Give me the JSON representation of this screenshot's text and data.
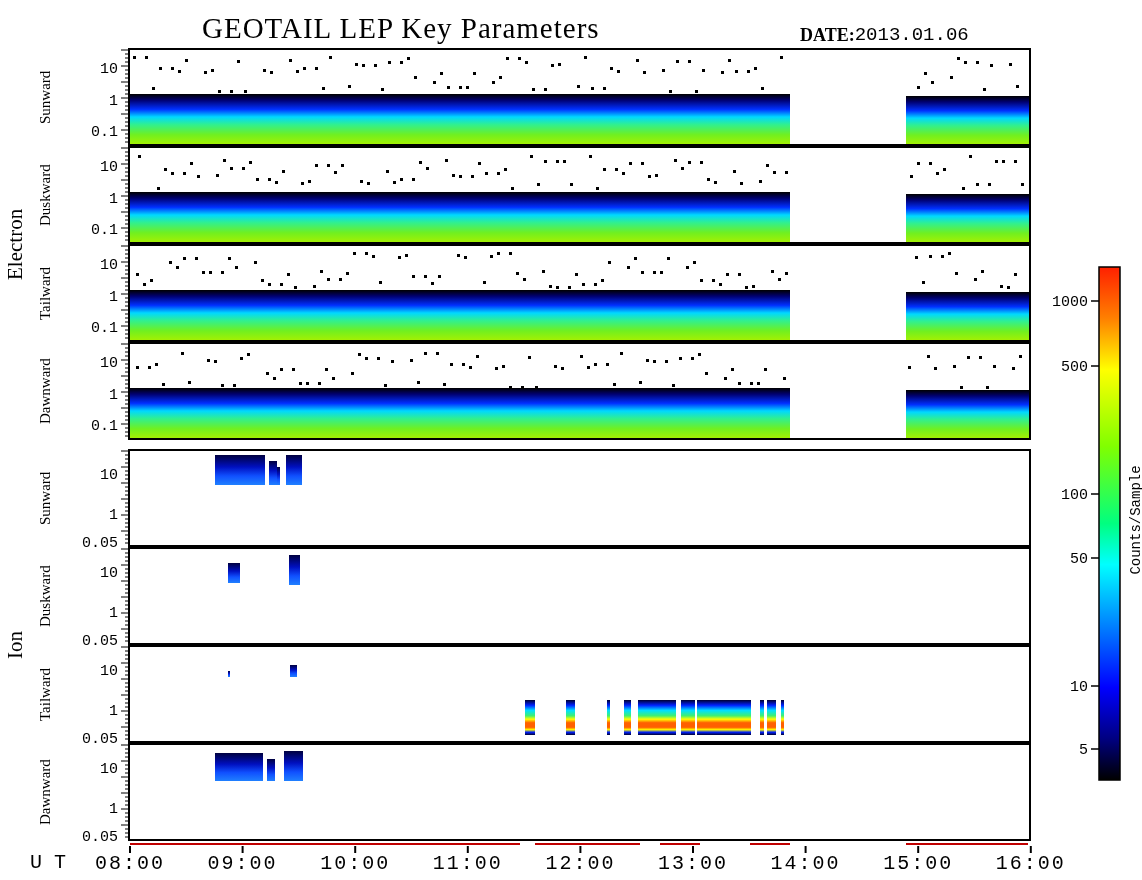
{
  "title": "GEOTAIL LEP Key Parameters",
  "date": {
    "label": "DATE:",
    "value": "2013.01.06"
  },
  "groups": [
    {
      "label": "Electron",
      "kind": "electron",
      "panels": [
        {
          "label": "Sunward",
          "yticks": [
            "10",
            "1",
            "0.1"
          ]
        },
        {
          "label": "Duskward",
          "yticks": [
            "10",
            "1",
            "0.1"
          ]
        },
        {
          "label": "Tailward",
          "yticks": [
            "10",
            "1",
            "0.1"
          ]
        },
        {
          "label": "Dawnward",
          "yticks": [
            "10",
            "1",
            "0.1"
          ]
        }
      ]
    },
    {
      "label": "Ion",
      "kind": "ion",
      "panels": [
        {
          "label": "Sunward",
          "yticks": [
            "10",
            "1",
            "0.05"
          ]
        },
        {
          "label": "Duskward",
          "yticks": [
            "10",
            "1",
            "0.05"
          ]
        },
        {
          "label": "Tailward",
          "yticks": [
            "10",
            "1",
            "0.05"
          ]
        },
        {
          "label": "Dawnward",
          "yticks": [
            "10",
            "1",
            "0.05"
          ]
        }
      ]
    }
  ],
  "time_axis": {
    "label": "U T",
    "ticks": [
      "08:00",
      "09:00",
      "10:00",
      "11:00",
      "12:00",
      "13:00",
      "14:00",
      "15:00",
      "16:00"
    ]
  },
  "colorbar": {
    "title": "Counts/Sample",
    "ticks": [
      "1000",
      "500",
      "100",
      "50",
      "10",
      "5"
    ]
  }
}
